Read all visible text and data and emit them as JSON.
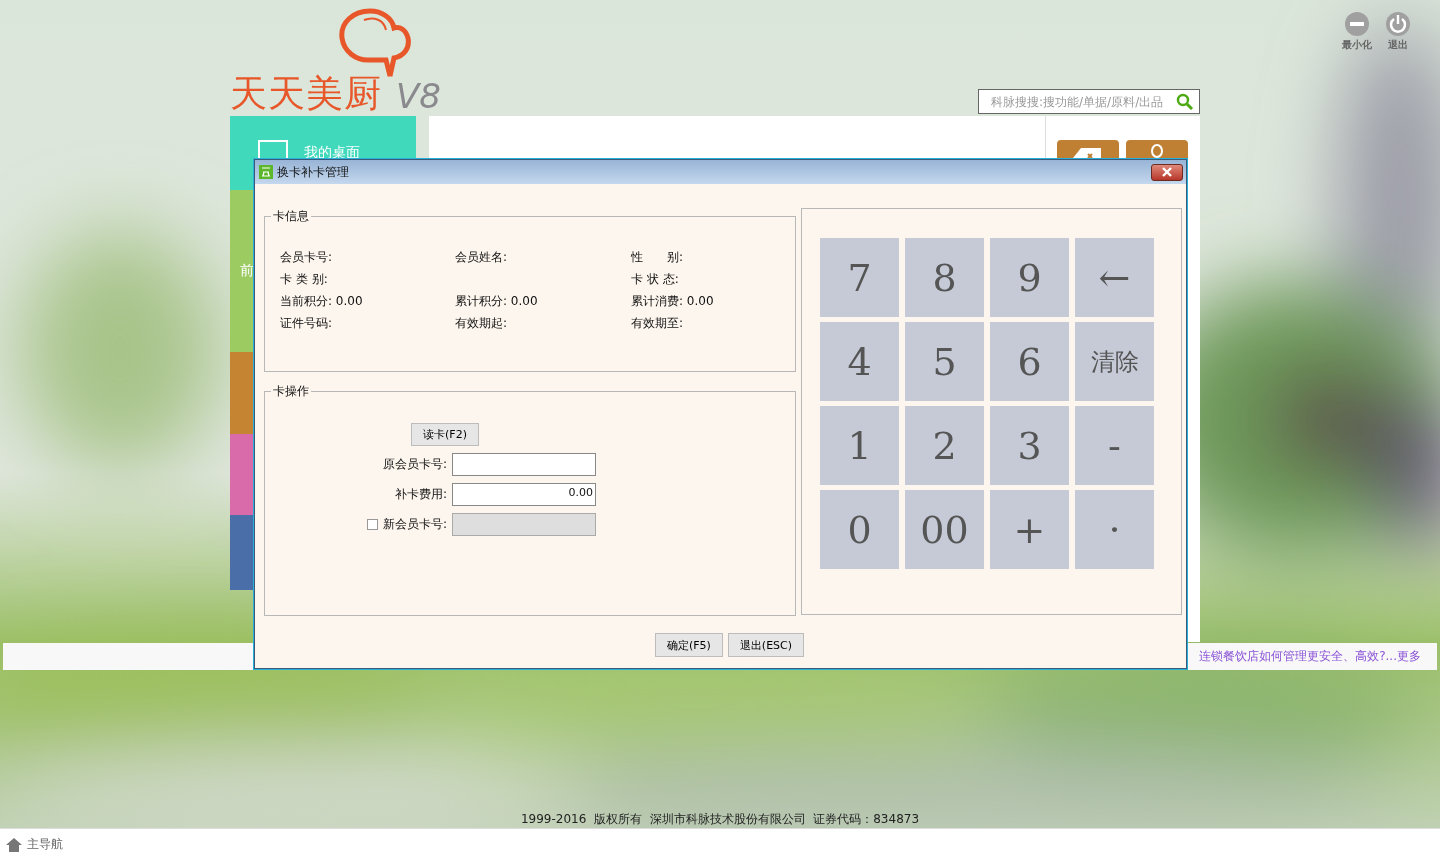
{
  "window_controls": [
    {
      "kind": "minimize",
      "label": "最小化"
    },
    {
      "kind": "exit",
      "label": "退出"
    }
  ],
  "logo": {
    "name": "天天美厨",
    "version": "V8"
  },
  "search": {
    "placeholder": "科脉搜搜:搜功能/单据/原料/出品"
  },
  "tiles": [
    {
      "kind": "desktop",
      "label": "我的桌面",
      "color": "#40d9bb"
    },
    {
      "kind": "front",
      "label": "前",
      "color": "#9ccb62"
    },
    {
      "kind": "person",
      "color": "#c48431"
    },
    {
      "kind": "card",
      "color": "#d96bab"
    },
    {
      "kind": "blank",
      "color": "#4a6fa8"
    }
  ],
  "quick_tiles": [
    {
      "kind": "eraser"
    },
    {
      "kind": "person"
    }
  ],
  "news_link": "连锁餐饮店如何管理更安全、高效?...更多",
  "copyright": "1999-2016  版权所有  深圳市科脉技术股份有限公司  证券代码：834873",
  "bottom_nav": {
    "label": "主导航"
  },
  "dialog": {
    "title": "换卡补卡管理",
    "card_info": {
      "title": "卡信息",
      "rows": [
        {
          "left": {
            "label": "会员卡号:"
          },
          "middle": {
            "label": "会员姓名:"
          },
          "right": {
            "label": "性　　别:"
          }
        },
        {
          "left": {
            "label": "卡 类 别:"
          },
          "right": {
            "label": "卡 状 态:"
          }
        },
        {
          "left": {
            "label": "当前积分:",
            "value": "0.00"
          },
          "middle": {
            "label": "累计积分:",
            "value": "0.00"
          },
          "right": {
            "label": "累计消费:",
            "value": "0.00"
          }
        },
        {
          "left": {
            "label": "证件号码:"
          },
          "middle": {
            "label": "有效期起:"
          },
          "right": {
            "label": "有效期至:"
          }
        }
      ]
    },
    "card_operation": {
      "title": "卡操作",
      "read_button": "读卡(F2)",
      "fields": [
        {
          "kind": "plain",
          "label": "原会员卡号:",
          "disabled": false
        },
        {
          "kind": "plain",
          "label": "补卡费用:",
          "value": "0.00",
          "disabled": false
        },
        {
          "kind": "checkbox",
          "label": "新会员卡号:",
          "checked": false,
          "disabled": true
        }
      ]
    },
    "keypad": [
      "7",
      "8",
      "9",
      "←",
      "4",
      "5",
      "6",
      "清除",
      "1",
      "2",
      "3",
      "-",
      "0",
      "00",
      "+",
      "·"
    ],
    "buttons": [
      "确定(F5)",
      "退出(ESC)"
    ]
  }
}
